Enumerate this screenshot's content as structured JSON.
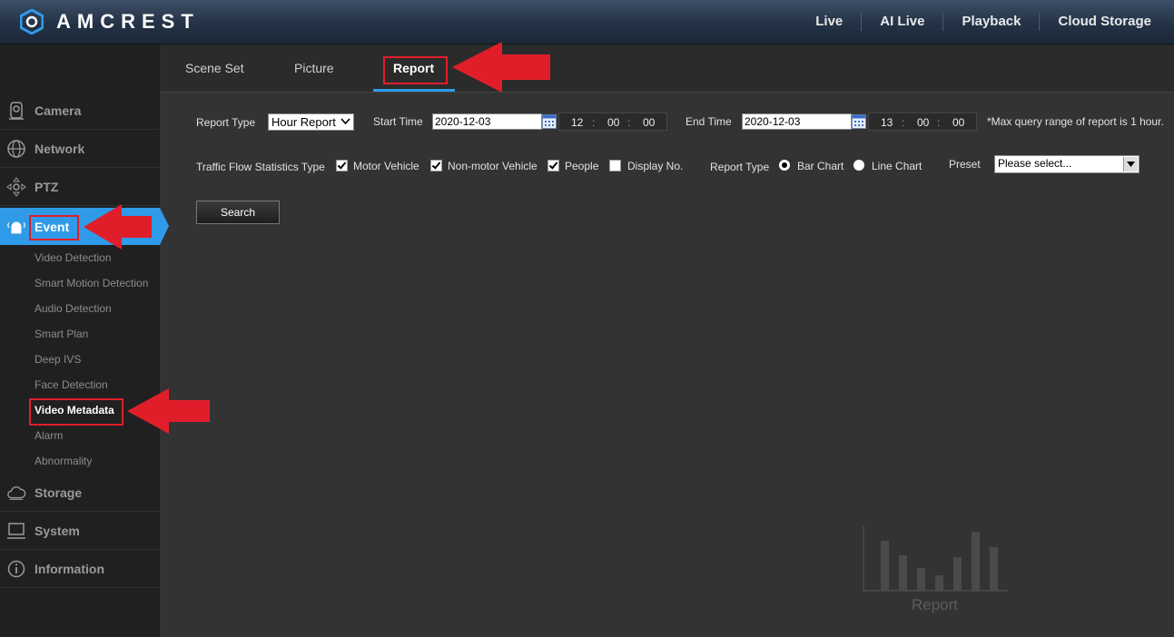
{
  "brand": {
    "name": "AMCREST"
  },
  "top_nav": [
    "Live",
    "AI Live",
    "Playback",
    "Cloud Storage"
  ],
  "sidebar": {
    "items": [
      {
        "label": "Camera",
        "icon": "camera-icon"
      },
      {
        "label": "Network",
        "icon": "globe-icon"
      },
      {
        "label": "PTZ",
        "icon": "ptz-icon"
      },
      {
        "label": "Event",
        "icon": "alarm-icon",
        "active": true
      },
      {
        "label": "Storage",
        "icon": "cloud-icon"
      },
      {
        "label": "System",
        "icon": "computer-icon"
      },
      {
        "label": "Information",
        "icon": "info-icon"
      }
    ],
    "event_sub": [
      "Video Detection",
      "Smart Motion Detection",
      "Audio Detection",
      "Smart Plan",
      "Deep IVS",
      "Face Detection",
      "Video Metadata",
      "Alarm",
      "Abnormality"
    ],
    "selected_sub": "Video Metadata"
  },
  "tabs": [
    {
      "label": "Scene Set"
    },
    {
      "label": "Picture"
    },
    {
      "label": "Report",
      "active": true
    }
  ],
  "form": {
    "report_type_label": "Report Type",
    "report_type_value": "Hour Report",
    "start_time_label": "Start Time",
    "start_date": "2020-12-03",
    "start_h": "12",
    "start_m": "00",
    "start_s": "00",
    "end_time_label": "End Time",
    "end_date": "2020-12-03",
    "end_h": "13",
    "end_m": "00",
    "end_s": "00",
    "max_note": "*Max query range of report is 1 hour.",
    "traffic_label": "Traffic Flow Statistics Type",
    "checkboxes": [
      {
        "label": "Motor Vehicle",
        "checked": true
      },
      {
        "label": "Non-motor Vehicle",
        "checked": true
      },
      {
        "label": "People",
        "checked": true
      },
      {
        "label": "Display No.",
        "checked": false
      }
    ],
    "chart_type_label": "Report Type",
    "radios": [
      {
        "label": "Bar Chart",
        "selected": true
      },
      {
        "label": "Line Chart",
        "selected": false
      }
    ],
    "preset_label": "Preset",
    "preset_value": "Please select...",
    "search_label": "Search"
  },
  "placeholder": {
    "label": "Report"
  },
  "colors": {
    "accent": "#2f9be8",
    "highlight": "#e01e2a"
  }
}
